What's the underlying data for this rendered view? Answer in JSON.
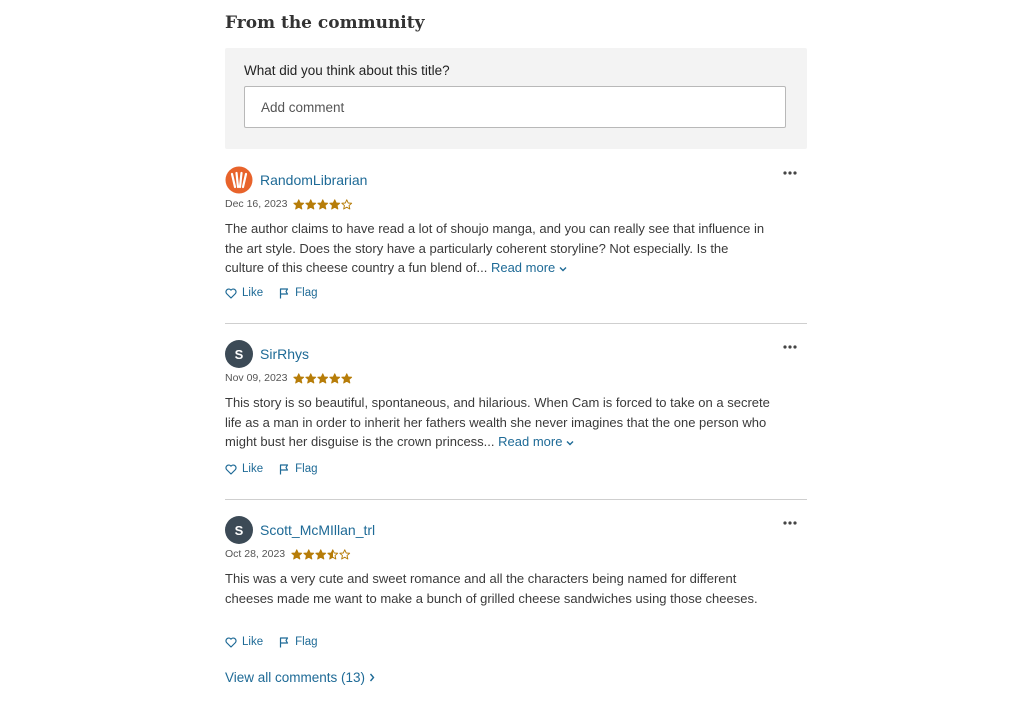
{
  "section": {
    "title": "From the community"
  },
  "comment_form": {
    "prompt": "What did you think about this title?",
    "placeholder": "Add comment"
  },
  "reviews": [
    {
      "user": "RandomLibrarian",
      "avatar": "librarian-logo",
      "date": "Dec 16, 2023",
      "rating": 4,
      "text": "The author claims to have read a lot of shoujo manga, and you can really see that influence in the art style. Does the story have a particularly coherent storyline? Not especially. Is the culture of this cheese country a fun blend of...",
      "read_more": "Read more",
      "like": "Like",
      "flag": "Flag"
    },
    {
      "user": "SirRhys",
      "avatar_initial": "S",
      "date": "Nov 09, 2023",
      "rating": 5,
      "text": "This story is so beautiful, spontaneous, and hilarious. When Cam is forced to take on a secrete life as a man in order to inherit her fathers wealth she never imagines that the one person who might bust her disguise is the crown princess...",
      "read_more": "Read more",
      "like": "Like",
      "flag": "Flag"
    },
    {
      "user": "Scott_McMIllan_trl",
      "avatar_initial": "S",
      "date": "Oct 28, 2023",
      "rating": 3.5,
      "text": "This was a very cute and sweet romance and all the characters being named for different cheeses made me want to make a bunch of grilled cheese sandwiches using those cheeses.",
      "like": "Like",
      "flag": "Flag"
    }
  ],
  "view_all": "View all comments (13)",
  "colors": {
    "link": "#1e6a96",
    "star": "#b77d09",
    "avatar_bg": "#3c4a56",
    "logo_orange": "#e8632b",
    "panel_bg": "#f3f3f3"
  }
}
